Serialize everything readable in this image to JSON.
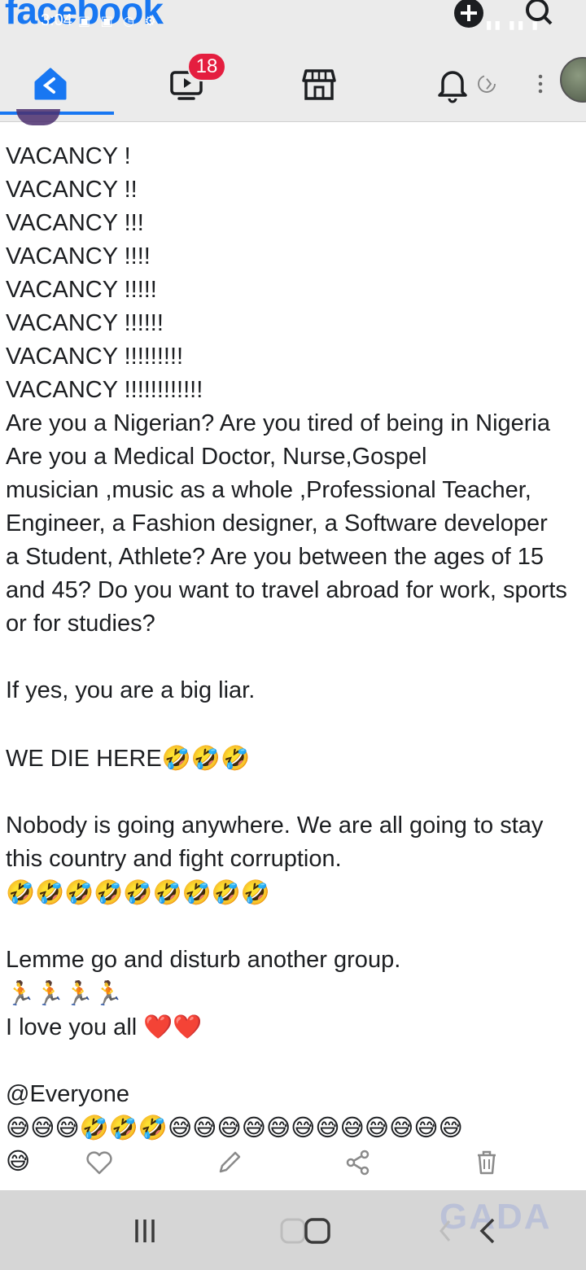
{
  "app": {
    "logo_text": "facebook",
    "brand_color": "#1877f2"
  },
  "status_bar": {
    "time": "3:04",
    "icons": "▣ ▣ ◷ ⚙"
  },
  "tabs": [
    {
      "name": "home",
      "active": true
    },
    {
      "name": "watch",
      "badge": "18"
    },
    {
      "name": "marketplace"
    },
    {
      "name": "notifications"
    },
    {
      "name": "menu"
    }
  ],
  "post": {
    "lines": [
      "VACANCY !",
      "VACANCY !!",
      "VACANCY !!!",
      "VACANCY !!!!",
      "VACANCY !!!!!",
      "VACANCY !!!!!!",
      "VACANCY !!!!!!!!!",
      "VACANCY !!!!!!!!!!!!",
      "Are you a Nigerian? Are you tired of being in Nigeria",
      "Are you a Medical Doctor, Nurse,Gospel",
      "musician ,music as a whole ,Professional Teacher,",
      "Engineer, a Fashion designer, a Software developer",
      "a Student, Athlete? Are you between the ages of 15",
      "and 45? Do you want to travel abroad for work, sports",
      "or for studies?"
    ],
    "liar_line": "If yes, you are a big liar.",
    "die_here_text": " WE DIE HERE",
    "die_here_emojis": "🤣🤣🤣",
    "nobody_line_1": " Nobody is going anywhere. We are all going to stay",
    "nobody_line_2": "this country and fight corruption.",
    "laugh_row": " 🤣🤣🤣🤣🤣🤣🤣🤣🤣",
    "lemme_line": "Lemme go and disturb another group.",
    "runners": "🏃🏃🏃🏃",
    "love_text": "I love you all ",
    "love_hearts": "❤️❤️",
    "mention": "@Everyone",
    "emoji_row_1": "😅😅😅🤣🤣🤣😅😅😅😅😅😅😅😅😅😅😅😅",
    "emoji_row_2": "😅"
  },
  "actions": [
    "like",
    "edit",
    "share",
    "delete"
  ],
  "watermark": "GADA"
}
